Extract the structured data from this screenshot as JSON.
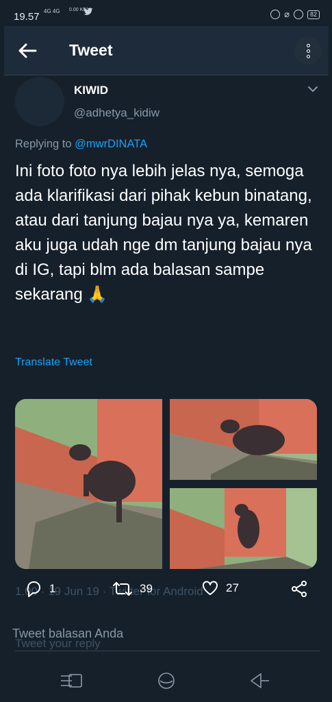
{
  "status_bar": {
    "time": "19.57",
    "signal": "4G 4G",
    "speed": "0.00 KB/s",
    "battery": "82"
  },
  "header": {
    "title": "Tweet"
  },
  "author": {
    "name": "KIWID",
    "handle": "@adhetya_kidiw"
  },
  "replying": {
    "prefix": "Replying to",
    "mention": "@mwrDINATA"
  },
  "tweet": {
    "text": "Ini foto foto nya lebih jelas nya, semoga ada klarifikasi dari pihak kebun binatang, atau dari tanjung bajau nya ya, kemaren aku juga udah nge dm tanjung bajau nya di IG, tapi blm ada balasan sampe sekarang 🙏",
    "translate_label": "Translate Tweet",
    "meta_ghost": "1.00 · 19 Jun 19 · Twitter for Android"
  },
  "actions": {
    "reply_count": "1",
    "retweet_count": "39",
    "like_count": "27"
  },
  "reply_box": {
    "label": "Tweet balasan Anda",
    "placeholder": "Tweet your reply"
  },
  "icons": {
    "back": "arrow-left-icon",
    "overflow": "more-vertical-icon",
    "caret": "chevron-down-icon",
    "reply": "comment-icon",
    "retweet": "retweet-icon",
    "like": "heart-icon",
    "share": "share-icon",
    "nav_menu": "menu-icon",
    "nav_home": "home-icon",
    "nav_back": "back-triangle-icon"
  },
  "colors": {
    "background": "#15202b",
    "header": "#1d2b3a",
    "accent": "#1da1f2",
    "secondary_text": "#8899a6"
  }
}
